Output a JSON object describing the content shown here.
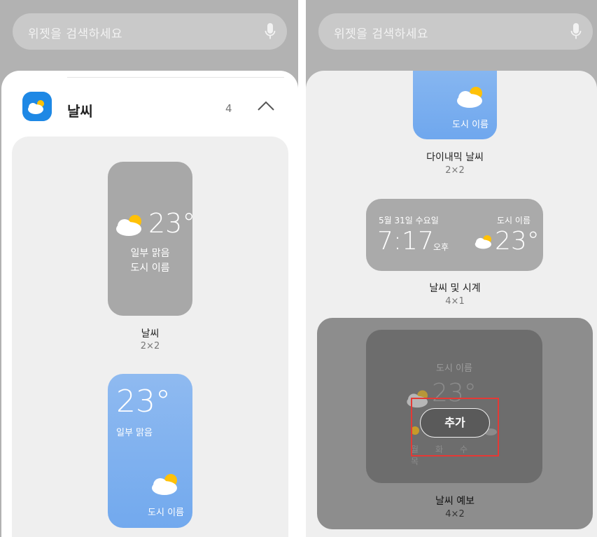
{
  "search": {
    "placeholder": "위젯을 검색하세요"
  },
  "app": {
    "name": "날씨",
    "count": "4"
  },
  "widgets_left": [
    {
      "temp": "23°",
      "condition": "일부 맑음",
      "city": "도시 이름",
      "label": "날씨",
      "size": "2×2"
    },
    {
      "temp": "23°",
      "condition": "일부 맑음",
      "city": "도시 이름"
    }
  ],
  "widgets_right": [
    {
      "city": "도시 이름",
      "label": "다이내믹 날씨",
      "size": "2×2"
    },
    {
      "date": "5월 31일 수요일",
      "city": "도시 이름",
      "time": "7:17",
      "ampm": "오후",
      "temp": "23°",
      "label": "날씨 및 시계",
      "size": "4×1"
    },
    {
      "city": "도시 이름",
      "temp": "23°",
      "days": [
        "월",
        "화",
        "수",
        "목"
      ],
      "label": "날씨 예보",
      "size": "4×2",
      "add_label": "추가"
    }
  ],
  "colors": {
    "highlight": "#e53935",
    "accent": "#1e88e5"
  }
}
